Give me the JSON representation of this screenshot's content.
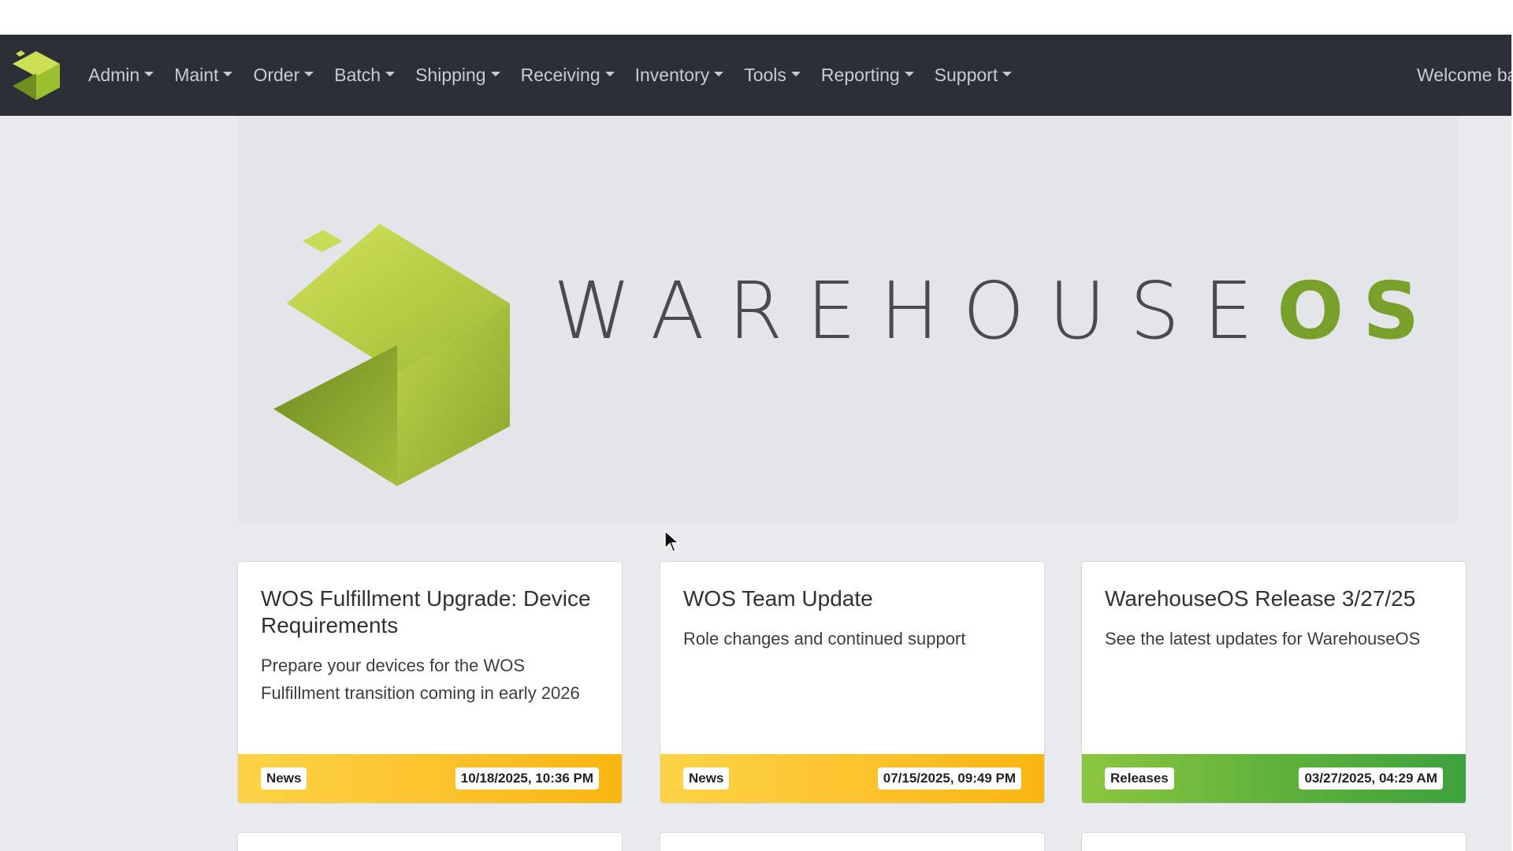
{
  "navbar": {
    "items": [
      {
        "label": "Admin"
      },
      {
        "label": "Maint"
      },
      {
        "label": "Order"
      },
      {
        "label": "Batch"
      },
      {
        "label": "Shipping"
      },
      {
        "label": "Receiving"
      },
      {
        "label": "Inventory"
      },
      {
        "label": "Tools"
      },
      {
        "label": "Reporting"
      },
      {
        "label": "Support"
      }
    ],
    "welcome_text": "Welcome ba"
  },
  "hero": {
    "logo_text_main": "WAREHOUSE",
    "logo_text_accent": "OS"
  },
  "cards": [
    {
      "title": "WOS Fulfillment Upgrade: Device Requirements",
      "text": "Prepare your devices for the WOS Fulfillment transition coming in early 2026",
      "category": "News",
      "date": "10/18/2025, 10:36 PM"
    },
    {
      "title": "WOS Team Update",
      "text": "Role changes and continued support",
      "category": "News",
      "date": "07/15/2025, 09:49 PM"
    },
    {
      "title": "WarehouseOS Release 3/27/25",
      "text": "See the latest updates for WarehouseOS",
      "category": "Releases",
      "date": "03/27/2025, 04:29 AM"
    }
  ],
  "colors": {
    "navbar_bg": "#2b3036",
    "page_bg": "#e9eaed",
    "brand_green": "#78a02b",
    "news_footer": "#fbc22b",
    "releases_footer": "#5bb03b"
  },
  "icons": {
    "brand": "warehouseos-cube-logo",
    "caret": "caret-down-icon",
    "cursor": "mouse-pointer-icon"
  }
}
